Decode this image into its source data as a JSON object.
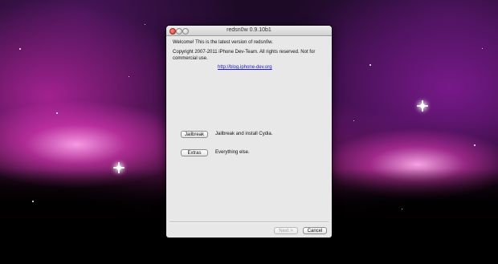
{
  "window": {
    "title": "redsn0w 0.9.10b1"
  },
  "content": {
    "welcome_text": "Welcome!  This is the latest version of redsn0w.",
    "copyright_text": "Copyright 2007-2011 iPhone Dev-Team. All rights reserved. Not for commercial use.",
    "link_text": "http://blog.iphone-dev.org"
  },
  "options": {
    "jailbreak_label": "Jailbreak",
    "jailbreak_desc": "Jailbreak and install Cydia.",
    "extras_label": "Extras",
    "extras_desc": "Everything else."
  },
  "footer": {
    "next_label": "Next >",
    "cancel_label": "Cancel"
  },
  "colors": {
    "link": "#1c1cc6",
    "close_button": "#d63b2f",
    "desktop_nebula": "#e040c0"
  }
}
